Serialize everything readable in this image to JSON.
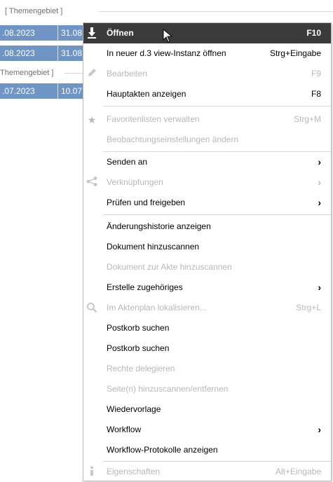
{
  "background": {
    "group1_header": "[ Themengebiet ]",
    "group2_header": "Themengebiet ]",
    "rows": [
      {
        "date1": ".08.2023",
        "date2": "31.08."
      },
      {
        "date1": ".08.2023",
        "date2": "31.08."
      },
      {
        "date1": ".07.2023",
        "date2": "10.07."
      }
    ]
  },
  "menu": {
    "items": [
      {
        "label": "Öffnen",
        "shortcut": "F10",
        "icon": "download-icon"
      },
      {
        "label": "In neuer d.3 view-Instanz öffnen",
        "shortcut": "Strg+Eingabe"
      },
      {
        "label": "Bearbeiten",
        "shortcut": "F9",
        "icon": "pencil-icon"
      },
      {
        "label": "Hauptakten anzeigen",
        "shortcut": "F8"
      },
      {
        "label": "Favoritenlisten verwalten",
        "shortcut": "Strg+M",
        "icon": "star-icon"
      },
      {
        "label": "Beobachtungseinstellungen ändern"
      },
      {
        "label": "Senden an",
        "arrow": "›"
      },
      {
        "label": "Verknüpfungen",
        "arrow": "›",
        "icon": "share-icon"
      },
      {
        "label": "Prüfen und freigeben",
        "arrow": "›"
      },
      {
        "label": "Änderungshistorie anzeigen"
      },
      {
        "label": "Dokument hinzuscannen"
      },
      {
        "label": "Dokument zur Akte hinzuscannen"
      },
      {
        "label": "Erstelle zugehöriges",
        "arrow": "›"
      },
      {
        "label": "Im Aktenplan lokalisieren...",
        "shortcut": "Strg+L",
        "icon": "search-icon"
      },
      {
        "label": "Postkorb suchen"
      },
      {
        "label": "Postkorb suchen"
      },
      {
        "label": "Rechte delegieren"
      },
      {
        "label": "Seite(n) hinzuscannen/entfernen"
      },
      {
        "label": "Wiedervorlage"
      },
      {
        "label": "Workflow",
        "arrow": "›"
      },
      {
        "label": "Workflow-Protokolle anzeigen"
      },
      {
        "label": "Eigenschaften",
        "shortcut": "Alt+Eingabe",
        "icon": "info-icon"
      }
    ]
  },
  "colors": {
    "row_selected": "#6f95c6",
    "menu_highlight": "#3b3b3b",
    "disabled_text": "#b8b8b8"
  }
}
